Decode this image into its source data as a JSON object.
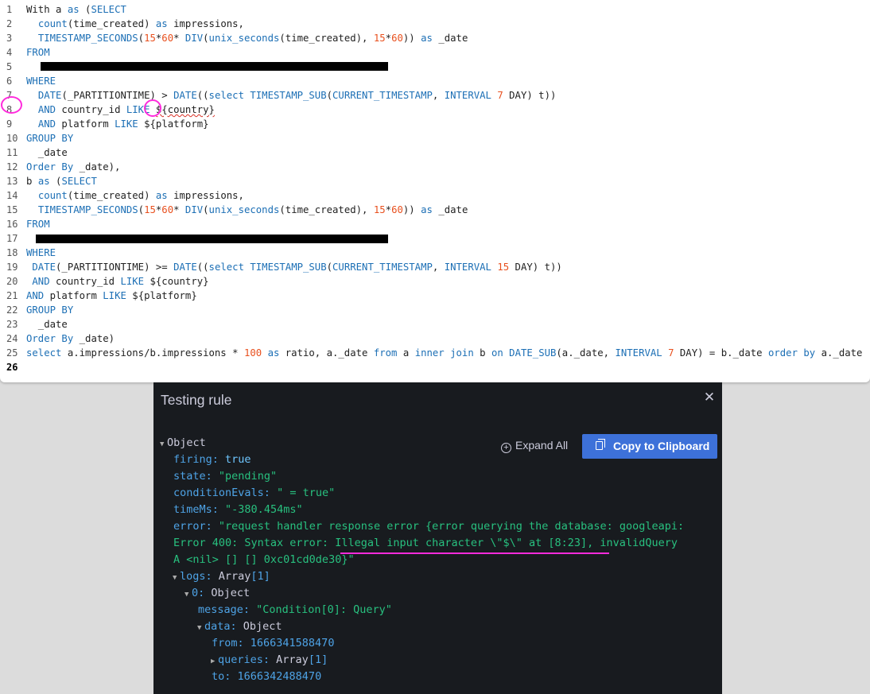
{
  "editor": {
    "line_numbers": [
      "1",
      "2",
      "3",
      "4",
      "5",
      "6",
      "7",
      "8",
      "9",
      "10",
      "11",
      "12",
      "13",
      "14",
      "15",
      "16",
      "17",
      "18",
      "19",
      "20",
      "21",
      "22",
      "23",
      "24",
      "25",
      "26"
    ],
    "active_line": "26",
    "lines": [
      [
        {
          "t": "With a ",
          "c": ""
        },
        {
          "t": "as",
          "c": "k"
        },
        {
          "t": " (",
          "c": ""
        },
        {
          "t": "SELECT",
          "c": "k"
        }
      ],
      [
        {
          "t": "  ",
          "c": ""
        },
        {
          "t": "count",
          "c": "k"
        },
        {
          "t": "(time_created) ",
          "c": ""
        },
        {
          "t": "as",
          "c": "k"
        },
        {
          "t": " impressions,",
          "c": ""
        }
      ],
      [
        {
          "t": "  ",
          "c": ""
        },
        {
          "t": "TIMESTAMP_SECONDS",
          "c": "k"
        },
        {
          "t": "(",
          "c": ""
        },
        {
          "t": "15",
          "c": "n"
        },
        {
          "t": "*",
          "c": ""
        },
        {
          "t": "60",
          "c": "n"
        },
        {
          "t": "* ",
          "c": ""
        },
        {
          "t": "DIV",
          "c": "k"
        },
        {
          "t": "(",
          "c": ""
        },
        {
          "t": "unix_seconds",
          "c": "k"
        },
        {
          "t": "(time_created), ",
          "c": ""
        },
        {
          "t": "15",
          "c": "n"
        },
        {
          "t": "*",
          "c": ""
        },
        {
          "t": "60",
          "c": "n"
        },
        {
          "t": ")) ",
          "c": ""
        },
        {
          "t": "as",
          "c": "k"
        },
        {
          "t": " _date",
          "c": ""
        }
      ],
      [
        {
          "t": "FROM",
          "c": "k"
        }
      ],
      [
        {
          "t": "",
          "c": ""
        }
      ],
      [
        {
          "t": "WHERE",
          "c": "k"
        }
      ],
      [
        {
          "t": "  ",
          "c": ""
        },
        {
          "t": "DATE",
          "c": "k"
        },
        {
          "t": "(_PARTITIONTIME) > ",
          "c": ""
        },
        {
          "t": "DATE",
          "c": "k"
        },
        {
          "t": "((",
          "c": ""
        },
        {
          "t": "select",
          "c": "k"
        },
        {
          "t": " ",
          "c": ""
        },
        {
          "t": "TIMESTAMP_SUB",
          "c": "k"
        },
        {
          "t": "(",
          "c": ""
        },
        {
          "t": "CURRENT_TIMESTAMP",
          "c": "k"
        },
        {
          "t": ", ",
          "c": ""
        },
        {
          "t": "INTERVAL",
          "c": "k"
        },
        {
          "t": " ",
          "c": ""
        },
        {
          "t": "7",
          "c": "n"
        },
        {
          "t": " DAY) t))",
          "c": ""
        }
      ],
      [
        {
          "t": "  ",
          "c": ""
        },
        {
          "t": "AND",
          "c": "k"
        },
        {
          "t": " country_id ",
          "c": ""
        },
        {
          "t": "LIKE",
          "c": "k"
        },
        {
          "t": " ",
          "c": ""
        },
        {
          "t": "${country}",
          "c": "squig"
        }
      ],
      [
        {
          "t": "  ",
          "c": ""
        },
        {
          "t": "AND",
          "c": "k"
        },
        {
          "t": " platform ",
          "c": ""
        },
        {
          "t": "LIKE",
          "c": "k"
        },
        {
          "t": " ${platform}",
          "c": ""
        }
      ],
      [
        {
          "t": "GROUP BY",
          "c": "k"
        }
      ],
      [
        {
          "t": "  _date",
          "c": ""
        }
      ],
      [
        {
          "t": "Order By",
          "c": "k"
        },
        {
          "t": " _date),",
          "c": ""
        }
      ],
      [
        {
          "t": "b ",
          "c": ""
        },
        {
          "t": "as",
          "c": "k"
        },
        {
          "t": " (",
          "c": ""
        },
        {
          "t": "SELECT",
          "c": "k"
        }
      ],
      [
        {
          "t": "  ",
          "c": ""
        },
        {
          "t": "count",
          "c": "k"
        },
        {
          "t": "(time_created) ",
          "c": ""
        },
        {
          "t": "as",
          "c": "k"
        },
        {
          "t": " impressions,",
          "c": ""
        }
      ],
      [
        {
          "t": "  ",
          "c": ""
        },
        {
          "t": "TIMESTAMP_SECONDS",
          "c": "k"
        },
        {
          "t": "(",
          "c": ""
        },
        {
          "t": "15",
          "c": "n"
        },
        {
          "t": "*",
          "c": ""
        },
        {
          "t": "60",
          "c": "n"
        },
        {
          "t": "* ",
          "c": ""
        },
        {
          "t": "DIV",
          "c": "k"
        },
        {
          "t": "(",
          "c": ""
        },
        {
          "t": "unix_seconds",
          "c": "k"
        },
        {
          "t": "(time_created), ",
          "c": ""
        },
        {
          "t": "15",
          "c": "n"
        },
        {
          "t": "*",
          "c": ""
        },
        {
          "t": "60",
          "c": "n"
        },
        {
          "t": ")) ",
          "c": ""
        },
        {
          "t": "as",
          "c": "k"
        },
        {
          "t": " _date",
          "c": ""
        }
      ],
      [
        {
          "t": "FROM",
          "c": "k"
        }
      ],
      [
        {
          "t": "",
          "c": ""
        }
      ],
      [
        {
          "t": "WHERE",
          "c": "k"
        }
      ],
      [
        {
          "t": " ",
          "c": ""
        },
        {
          "t": "DATE",
          "c": "k"
        },
        {
          "t": "(_PARTITIONTIME) >= ",
          "c": ""
        },
        {
          "t": "DATE",
          "c": "k"
        },
        {
          "t": "((",
          "c": ""
        },
        {
          "t": "select",
          "c": "k"
        },
        {
          "t": " ",
          "c": ""
        },
        {
          "t": "TIMESTAMP_SUB",
          "c": "k"
        },
        {
          "t": "(",
          "c": ""
        },
        {
          "t": "CURRENT_TIMESTAMP",
          "c": "k"
        },
        {
          "t": ", ",
          "c": ""
        },
        {
          "t": "INTERVAL",
          "c": "k"
        },
        {
          "t": " ",
          "c": ""
        },
        {
          "t": "15",
          "c": "n"
        },
        {
          "t": " DAY) t))",
          "c": ""
        }
      ],
      [
        {
          "t": " ",
          "c": ""
        },
        {
          "t": "AND",
          "c": "k"
        },
        {
          "t": " country_id ",
          "c": ""
        },
        {
          "t": "LIKE",
          "c": "k"
        },
        {
          "t": " ${country}",
          "c": ""
        }
      ],
      [
        {
          "t": "AND",
          "c": "k"
        },
        {
          "t": " platform ",
          "c": ""
        },
        {
          "t": "LIKE",
          "c": "k"
        },
        {
          "t": " ${platform}",
          "c": ""
        }
      ],
      [
        {
          "t": "GROUP BY",
          "c": "k"
        }
      ],
      [
        {
          "t": "  _date",
          "c": ""
        }
      ],
      [
        {
          "t": "Order By",
          "c": "k"
        },
        {
          "t": " _date)",
          "c": ""
        }
      ],
      [
        {
          "t": "select",
          "c": "k"
        },
        {
          "t": " a.impressions/b.impressions * ",
          "c": ""
        },
        {
          "t": "100",
          "c": "n"
        },
        {
          "t": " ",
          "c": ""
        },
        {
          "t": "as",
          "c": "k"
        },
        {
          "t": " ratio, a._date ",
          "c": ""
        },
        {
          "t": "from",
          "c": "k"
        },
        {
          "t": " a ",
          "c": ""
        },
        {
          "t": "inner join",
          "c": "k"
        },
        {
          "t": " b ",
          "c": ""
        },
        {
          "t": "on",
          "c": "k"
        },
        {
          "t": " ",
          "c": ""
        },
        {
          "t": "DATE_SUB",
          "c": "k"
        },
        {
          "t": "(a._date, ",
          "c": ""
        },
        {
          "t": "INTERVAL",
          "c": "k"
        },
        {
          "t": " ",
          "c": ""
        },
        {
          "t": "7",
          "c": "n"
        },
        {
          "t": " DAY) = b._date ",
          "c": ""
        },
        {
          "t": "order by",
          "c": "k"
        },
        {
          "t": " a._date",
          "c": ""
        }
      ],
      [
        {
          "t": "",
          "c": ""
        }
      ]
    ]
  },
  "panel": {
    "title": "Testing rule",
    "close_icon": "close-icon",
    "expand_all": "Expand All",
    "copy_label": "Copy to Clipboard",
    "colors": {
      "accent": "#3d71d9",
      "key": "#4ea3e6",
      "string": "#28c07f",
      "annotation": "#ff2bdc"
    },
    "tree": {
      "root": "Object",
      "firing_key": "firing:",
      "firing_val": "true",
      "state_key": "state:",
      "state_val": "\"pending\"",
      "cond_key": "conditionEvals:",
      "cond_val": "\" = true\"",
      "time_key": "timeMs:",
      "time_val": "\"-380.454ms\"",
      "error_key": "error:",
      "error_l1": "\"request handler response error {error querying the database: googleapi:",
      "error_l2": "Error 400: Syntax error: Illegal input character \\\"$\\\" at [8:23], invalidQuery",
      "error_l3": "A <nil> [] [] 0xc01cd0de30}\"",
      "logs_key": "logs:",
      "logs_type": "Array",
      "logs_count": "[1]",
      "log0_key": "0:",
      "log0_type": "Object",
      "message_key": "message:",
      "message_val": "\"Condition[0]: Query\"",
      "data_key": "data:",
      "data_type": "Object",
      "from_key": "from:",
      "from_val": "1666341588470",
      "queries_key": "queries:",
      "queries_type": "Array",
      "queries_count": "[1]",
      "to_key": "to:",
      "to_val": "1666342488470"
    }
  }
}
